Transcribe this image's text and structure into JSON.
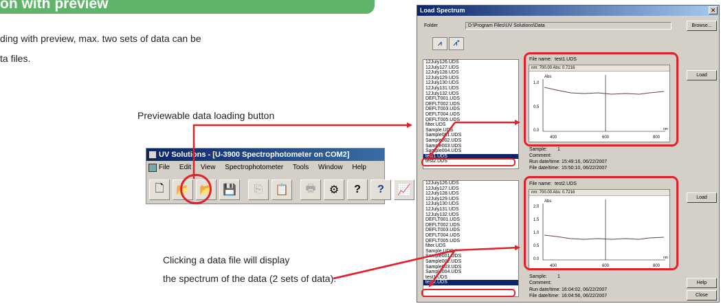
{
  "banner": {
    "text": "on with preview"
  },
  "description": {
    "line1": "ding with preview, max. two sets of data can be",
    "line2": "ta files."
  },
  "annotations": {
    "load_button_label": "Previewable data loading button",
    "click_line1": "Clicking a data file will display",
    "click_line2": "the spectrum of the data (2 sets of data)."
  },
  "colors": {
    "annotation_red": "#e32029",
    "banner_green": "#5fb46a",
    "title_blue": "#0a246a"
  },
  "app": {
    "title": "UV Solutions - [U-3900 Spectrophotometer on COM2]",
    "menu": [
      "File",
      "Edit",
      "View",
      "Spectrophotometer",
      "Tools",
      "Window",
      "Help"
    ],
    "toolbar": [
      {
        "icon": "new-file-icon",
        "glyph": "🗋"
      },
      {
        "icon": "open-folder-icon",
        "glyph": "📂"
      },
      {
        "icon": "load-with-preview-icon",
        "glyph": "📂"
      },
      {
        "icon": "save-icon",
        "glyph": "💾"
      },
      {
        "icon": "copy-icon",
        "glyph": "⎘"
      },
      {
        "icon": "paste-icon",
        "glyph": "📋"
      },
      {
        "icon": "print-icon",
        "glyph": "🖶"
      },
      {
        "icon": "settings-gears-icon",
        "glyph": "⚙"
      },
      {
        "icon": "help-icon",
        "glyph": "?"
      },
      {
        "icon": "context-help-icon",
        "glyph": "?"
      },
      {
        "icon": "spectrum-window-icon",
        "glyph": "📈"
      }
    ]
  },
  "dialog": {
    "title": "Load Spectrum",
    "folder_label": "Folder",
    "folder_path": "D:\\Program Files\\UV Solutions\\Data",
    "browse_button": "Browse...",
    "load_button": "Load",
    "help_button": "Help",
    "close_button": "Close",
    "list1": [
      "12July126.UDS",
      "12July127.UDS",
      "12July128.UDS",
      "12July129.UDS",
      "12July130.UDS",
      "12July131.UDS",
      "12July132.UDS",
      "DEFLT001.UDS",
      "DEFLT002.UDS",
      "DEFLT003.UDS",
      "DEFLT004.UDS",
      "DEFLT005.UDS",
      "filter.UDS",
      "Sample.UDS",
      "Sample001.UDS",
      "Sample002.UDS",
      "Sample003.UDS",
      "Sample004.UDS",
      "test1.UDS",
      "test2.UDS"
    ],
    "list1_selected": "test1.UDS",
    "list2": [
      "12July126.UDS",
      "12July127.UDS",
      "12July128.UDS",
      "12July129.UDS",
      "12July130.UDS",
      "12July131.UDS",
      "12July132.UDS",
      "DEFLT001.UDS",
      "DEFLT002.UDS",
      "DEFLT003.UDS",
      "DEFLT004.UDS",
      "DEFLT005.UDS",
      "filter.UDS",
      "Sample.UDS",
      "Sample001.UDS",
      "Sample002.UDS",
      "Sample003.UDS",
      "Sample004.UDS",
      "test1.UDS",
      "test2.UDS"
    ],
    "list2_selected": "test2.UDS",
    "preview1": {
      "file_name_label": "File name:",
      "file_name": "test1.UDS",
      "cursor_readout": "nm: 700.00  Abs: 0.7216",
      "y_unit": "Abs",
      "x_unit": "nm",
      "y_ticks": [
        "1.0",
        "0.5",
        "0.0"
      ],
      "x_ticks": [
        "400",
        "600",
        "800"
      ],
      "sample_label": "Sample:",
      "sample_value": "1",
      "comment_label": "Comment:",
      "run_label": "Run date/time:",
      "run_value": "15:49:16, 06/22/2007",
      "file_label": "File date/time:",
      "file_value": "15:50:10, 06/22/2007"
    },
    "preview2": {
      "file_name_label": "File name:",
      "file_name": "test2.UDS",
      "cursor_readout": "nm: 700.00  Abs: 0.7216",
      "y_unit": "Abs",
      "x_unit": "nm",
      "y_ticks": [
        "2.0",
        "1.5",
        "1.0",
        "0.5",
        "0.0"
      ],
      "x_ticks": [
        "400",
        "600",
        "800"
      ],
      "sample_label": "Sample:",
      "sample_value": "1",
      "comment_label": "Comment:",
      "run_label": "Run date/time:",
      "run_value": "16:04:02, 06/22/2007",
      "file_label": "File date/time:",
      "file_value": "16:04:56, 06/22/2007"
    }
  }
}
